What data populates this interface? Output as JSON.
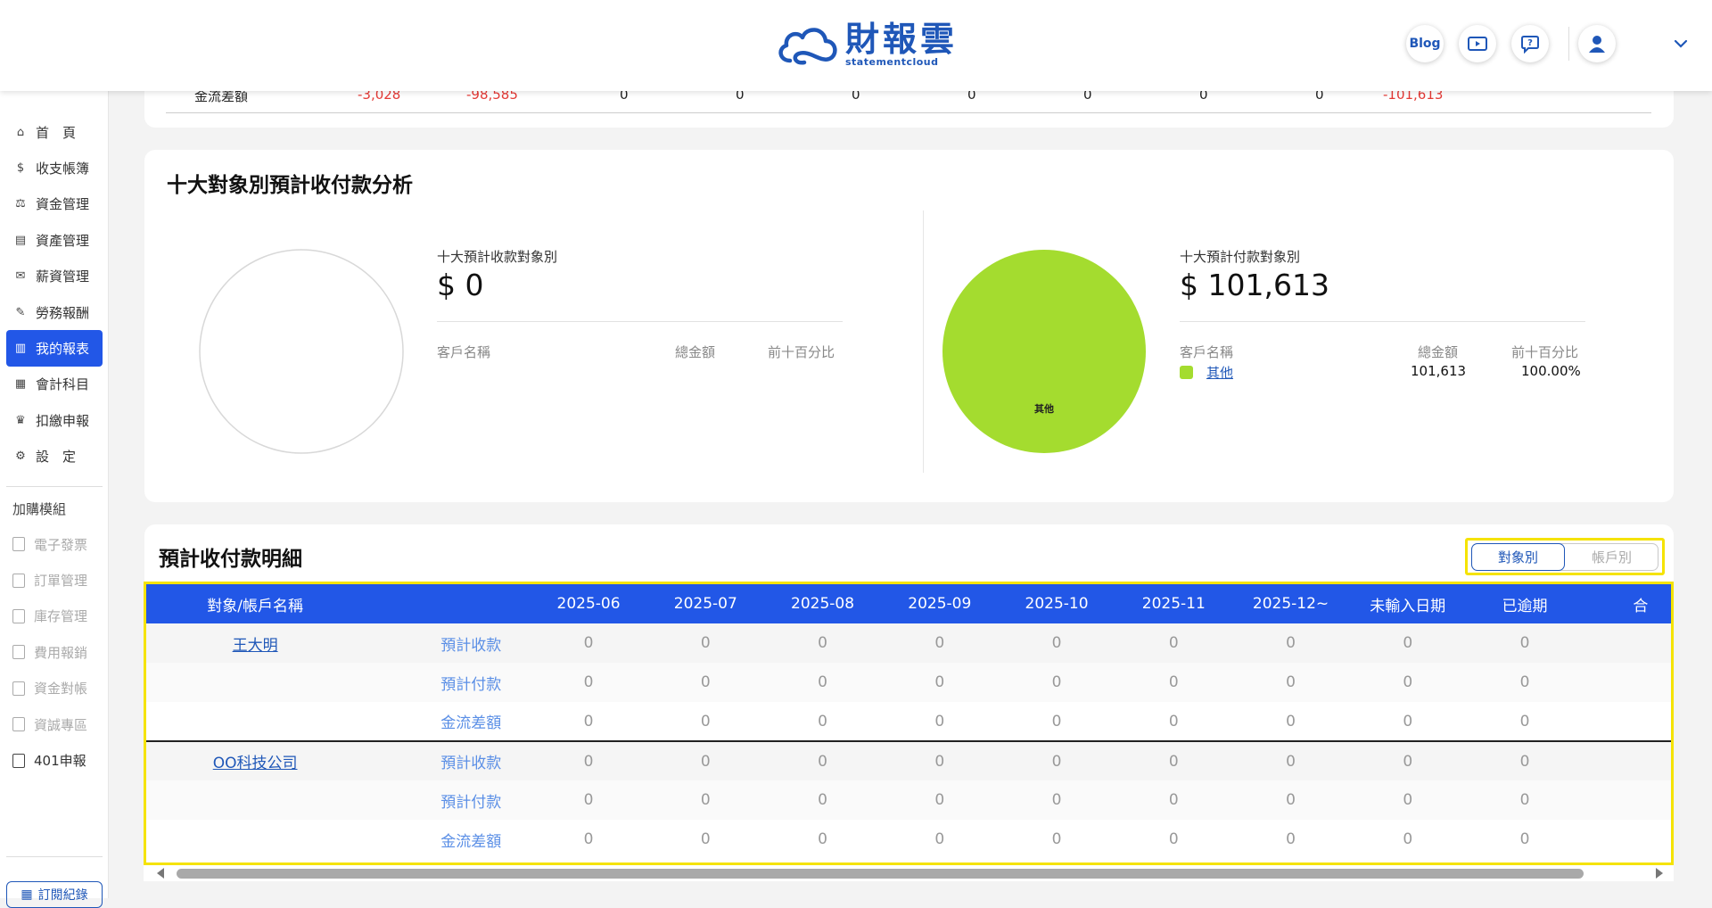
{
  "header": {
    "logo_name": "財報雲",
    "logo_sub": "statementcloud",
    "blog_label": "Blog",
    "icons": [
      "video-guide-icon",
      "help-chat-icon",
      "user-avatar-icon",
      "chevron-down-icon"
    ]
  },
  "sidebar": {
    "items": [
      {
        "label": "首　頁",
        "icon": "home-icon"
      },
      {
        "label": "收支帳簿",
        "icon": "ledger-icon"
      },
      {
        "label": "資金管理",
        "icon": "funds-icon"
      },
      {
        "label": "資產管理",
        "icon": "assets-icon"
      },
      {
        "label": "薪資管理",
        "icon": "salary-icon"
      },
      {
        "label": "勞務報酬",
        "icon": "service-fee-icon"
      },
      {
        "label": "我的報表",
        "icon": "chart-icon",
        "active": true
      },
      {
        "label": "會計科目",
        "icon": "accounts-icon"
      },
      {
        "label": "扣繳申報",
        "icon": "withholding-icon"
      },
      {
        "label": "設　定",
        "icon": "settings-icon"
      }
    ],
    "addon_title": "加購模組",
    "addons": [
      {
        "label": "電子發票"
      },
      {
        "label": "訂單管理"
      },
      {
        "label": "庫存管理"
      },
      {
        "label": "費用報銷"
      },
      {
        "label": "資金對帳"
      },
      {
        "label": "資誠專區"
      },
      {
        "label": "401申報"
      }
    ],
    "subscription_label": "訂閱紀錄"
  },
  "cashflow_row": {
    "label": "金流差額",
    "values": [
      "-3,028",
      "-98,585",
      "0",
      "0",
      "0",
      "0",
      "0",
      "0",
      "0",
      "-101,613"
    ]
  },
  "analysis": {
    "title": "十大對象別預計收付款分析",
    "receivable": {
      "label": "十大預計收款對象別",
      "amount": "$ 0",
      "col_name": "客戶名稱",
      "col_total": "總金額",
      "col_pct": "前十百分比"
    },
    "payable": {
      "label": "十大預計付款對象別",
      "amount": "$ 101,613",
      "col_name": "客戶名稱",
      "col_total": "總金額",
      "col_pct": "前十百分比",
      "rows": [
        {
          "name": "其他",
          "total": "101,613",
          "pct": "100.00%",
          "color": "#a4dc2f"
        }
      ],
      "pie_label": "其他"
    }
  },
  "detail": {
    "title": "預計收付款明細",
    "toggle_object": "對象別",
    "toggle_account": "帳戶別",
    "columns": [
      "對象/帳戶名稱",
      "",
      "2025-06",
      "2025-07",
      "2025-08",
      "2025-09",
      "2025-10",
      "2025-11",
      "2025-12~",
      "未輸入日期",
      "已逾期",
      "合"
    ],
    "groups": [
      {
        "name": "王大明",
        "rows": [
          {
            "kind": "預計收款",
            "values": [
              "0",
              "0",
              "0",
              "0",
              "0",
              "0",
              "0",
              "0",
              "0"
            ]
          },
          {
            "kind": "預計付款",
            "values": [
              "0",
              "0",
              "0",
              "0",
              "0",
              "0",
              "0",
              "0",
              "0"
            ]
          },
          {
            "kind": "金流差額",
            "values": [
              "0",
              "0",
              "0",
              "0",
              "0",
              "0",
              "0",
              "0",
              "0"
            ]
          }
        ]
      },
      {
        "name": "OO科技公司",
        "rows": [
          {
            "kind": "預計收款",
            "values": [
              "0",
              "0",
              "0",
              "0",
              "0",
              "0",
              "0",
              "0",
              "0"
            ]
          },
          {
            "kind": "預計付款",
            "values": [
              "0",
              "0",
              "0",
              "0",
              "0",
              "0",
              "0",
              "0",
              "0"
            ]
          },
          {
            "kind": "金流差額",
            "values": [
              "0",
              "0",
              "0",
              "0",
              "0",
              "0",
              "0",
              "0",
              "0"
            ]
          }
        ]
      }
    ]
  },
  "colors": {
    "primary": "#2257e7",
    "brand": "#1f57b8",
    "negative": "#e53935",
    "pie_other": "#a4dc2f",
    "highlight": "#f5e300"
  }
}
